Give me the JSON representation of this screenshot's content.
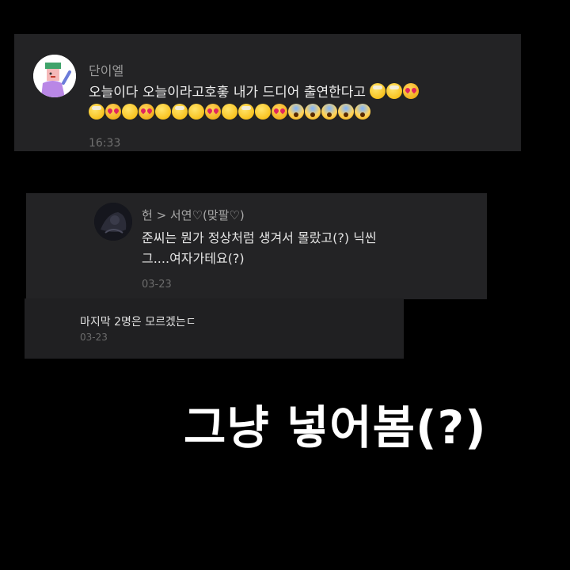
{
  "comment1": {
    "author": "단이엘",
    "text_line1": "오늘이다 오늘이라고호홓 내가 드디어 출연한다고",
    "emojis_line1": [
      "mind-blown",
      "mind-blown",
      "heart-eyes"
    ],
    "emojis_line2": [
      "mind-blown",
      "heart-eyes",
      "shocked",
      "heart-eyes",
      "shocked",
      "mind-blown",
      "shocked",
      "heart-eyes",
      "shocked",
      "mind-blown",
      "shocked",
      "heart-eyes",
      "screaming",
      "screaming",
      "screaming",
      "screaming",
      "screaming"
    ],
    "time": "16:33"
  },
  "comment2": {
    "author": "헌 > 서연♡(맞팔♡)",
    "text_line1": "준씨는 뭔가 정상처럼 생겨서 몰랐고(?) 닉씬",
    "text_line2": "그....여자가테요(?)",
    "date": "03-23"
  },
  "comment3": {
    "text": "마지막 2명은 모르겠는ㄷ",
    "date": "03-23"
  },
  "caption": "그냥 넣어봄(?)"
}
